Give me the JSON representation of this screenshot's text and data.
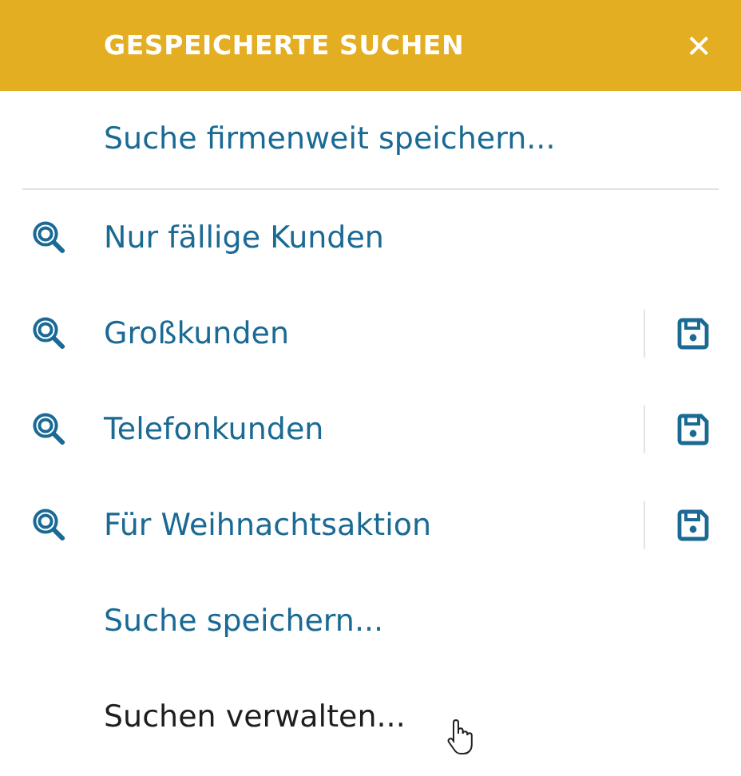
{
  "header": {
    "title": "GESPEICHERTE SUCHEN",
    "close": "✕"
  },
  "top_action": {
    "label": "Suche firmenweit speichern...",
    "hovered": false
  },
  "saved_searches": [
    {
      "label": "Nur fällige Kunden",
      "savable": false
    },
    {
      "label": "Großkunden",
      "savable": true
    },
    {
      "label": "Telefonkunden",
      "savable": true
    },
    {
      "label": "Für Weihnachtsaktion",
      "savable": true
    }
  ],
  "actions": [
    {
      "label": "Suche speichern...",
      "hovered": false
    },
    {
      "label": "Suchen verwalten...",
      "hovered": true
    }
  ]
}
